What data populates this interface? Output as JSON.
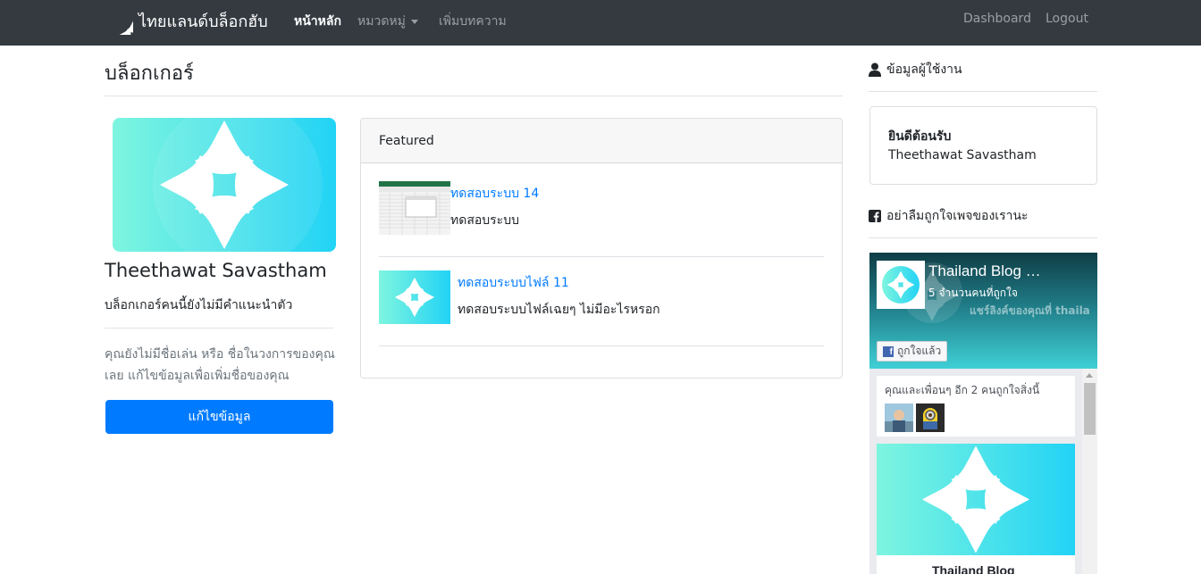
{
  "navbar": {
    "brand": "ไทยแลนด์บล็อกฮับ",
    "links": {
      "home": "หน้าหลัก",
      "category": "หมวดหมู่",
      "add_post": "เพิ่มบทความ",
      "dashboard": "Dashboard",
      "logout": "Logout"
    }
  },
  "page": {
    "title": "บล็อกเกอร์"
  },
  "profile": {
    "name": "Theethawat Savastham",
    "bio": "บล็อกเกอร์คนนี้ยังไม่มีคำแนะนำตัว",
    "note": "คุณยังไม่มีชื่อเล่น หรือ ชื่อในวงการของคุณเลย แก้ไขข้อมูลเพื่อเพิ่มชื่อของคุณ",
    "edit_button": "แก้ไขข้อมูล"
  },
  "featured": {
    "header": "Featured",
    "posts": [
      {
        "title": "ทดสอบระบบ 14",
        "description": "ทดสอบระบบ"
      },
      {
        "title": "ทดสอบระบบไฟล์ 11",
        "description": "ทดสอบระบบไฟล์เฉยๆ ไม่มีอะไรหรอก"
      }
    ]
  },
  "sidebar": {
    "user_heading": "ข้อมูลผู้ใช้งาน",
    "welcome_title": "ยินดีต้อนรับ",
    "welcome_name": "Theethawat Savastham",
    "fb_heading": "อย่าลืมถูกใจเพจของเรานะ"
  },
  "fb_widget": {
    "page_name": "Thailand Blog …",
    "likes": "5 จำนวนคนที่ถูกใจ",
    "cover_text": "แชร์ลิงค์ของคุณที่ thaila",
    "like_button": "ถูกใจแล้ว",
    "friends_text": "คุณและเพื่อนๆ อีก 2 คนถูกใจสิ่งนี้",
    "post_page_name": "Thailand Blog"
  },
  "colors": {
    "navbar_bg": "#343a40",
    "primary": "#007bff",
    "brand_gradient_start": "#7ef5df",
    "brand_gradient_end": "#22d3f5"
  }
}
